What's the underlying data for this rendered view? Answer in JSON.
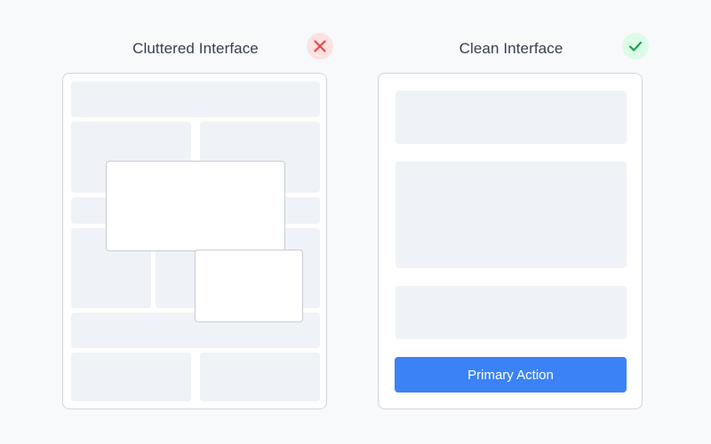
{
  "cluttered": {
    "title": "Cluttered Interface",
    "badge_icon": "x-icon",
    "badge_color": "#ef4444",
    "badge_bg": "#fde2e2"
  },
  "clean": {
    "title": "Clean Interface",
    "badge_icon": "check-icon",
    "badge_color": "#16a34a",
    "badge_bg": "#dcfce7",
    "primary_button_label": "Primary Action",
    "primary_button_color": "#3b82f6"
  },
  "colors": {
    "background": "#f8f9fb",
    "block": "#eff2f7",
    "panel_border": "#d1d5db"
  }
}
